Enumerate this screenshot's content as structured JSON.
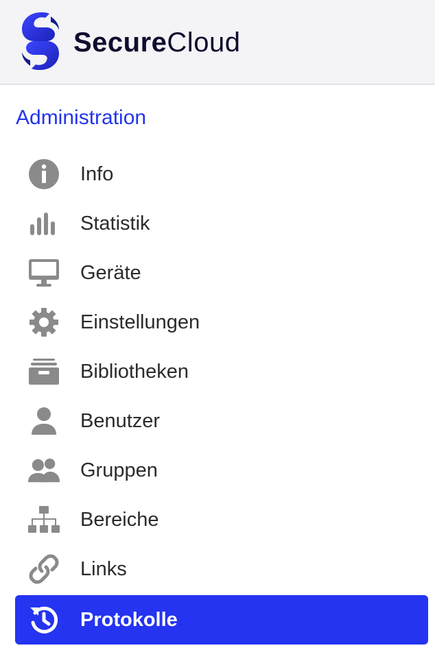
{
  "header": {
    "brand_bold": "Secure",
    "brand_light": "Cloud",
    "accent_color": "#2434f0"
  },
  "section": {
    "title": "Administration"
  },
  "nav": {
    "items": [
      {
        "label": "Info",
        "icon": "info-icon"
      },
      {
        "label": "Statistik",
        "icon": "bar-chart-icon"
      },
      {
        "label": "Geräte",
        "icon": "monitor-icon"
      },
      {
        "label": "Einstellungen",
        "icon": "gear-icon"
      },
      {
        "label": "Bibliotheken",
        "icon": "archive-icon"
      },
      {
        "label": "Benutzer",
        "icon": "user-icon"
      },
      {
        "label": "Gruppen",
        "icon": "users-icon"
      },
      {
        "label": "Bereiche",
        "icon": "sitemap-icon"
      },
      {
        "label": "Links",
        "icon": "link-icon"
      },
      {
        "label": "Protokolle",
        "icon": "history-icon",
        "active": true
      }
    ]
  }
}
